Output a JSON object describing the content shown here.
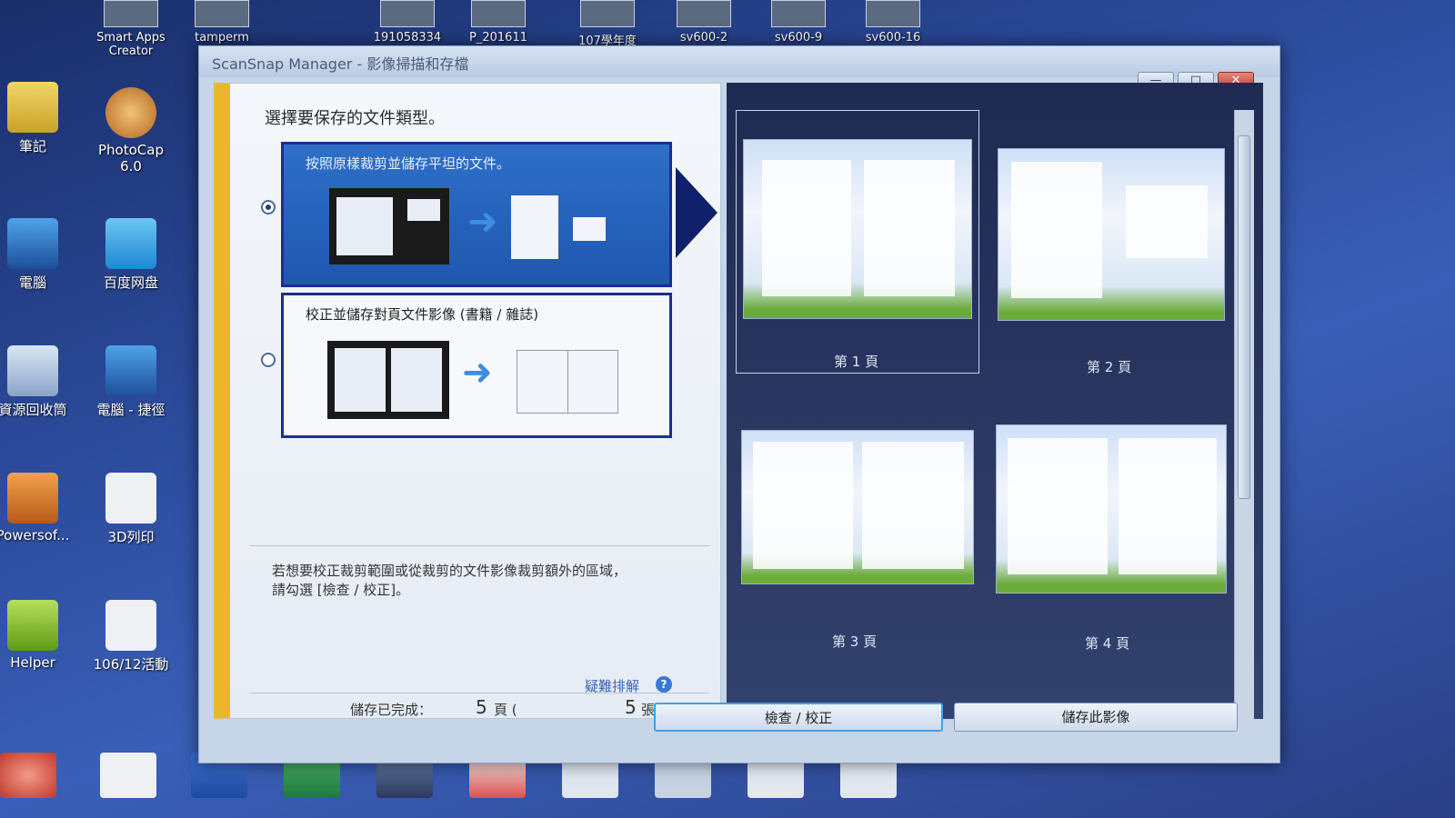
{
  "desktop": {
    "top_icons": [
      "Smart Apps Creator",
      "tamperm",
      "191058334",
      "P_201611",
      "107學年度",
      "sv600-2",
      "sv600-9",
      "sv600-16"
    ],
    "left_icons": [
      {
        "label": "筆記"
      },
      {
        "label": "PhotoCap 6.0"
      },
      {
        "label": "電腦"
      },
      {
        "label": "百度网盘"
      },
      {
        "label": "資源回收筒"
      },
      {
        "label": "電腦 - 捷徑"
      },
      {
        "label": "Powersof..."
      },
      {
        "label": "3D列印"
      },
      {
        "label": "Helper"
      },
      {
        "label": "106/12活動"
      }
    ]
  },
  "window": {
    "title": "ScanSnap Manager - 影像掃描和存檔",
    "buttons": {
      "minimize": "—",
      "maximize": "□",
      "close": "✕"
    }
  },
  "left_panel": {
    "prompt": "選擇要保存的文件類型。",
    "option1_label": "按照原樣裁剪並儲存平坦的文件。",
    "option2_label": "校正並儲存對頁文件影像 (書籍 / 雜誌)",
    "note_line1": "若想要校正裁剪範圍或從裁剪的文件影像裁剪額外的區域，",
    "note_line2": "請勾選 [檢查 / 校正]。",
    "troubleshoot": "疑難排解",
    "help": "?",
    "status_label": "儲存已完成：",
    "pages_count": "5",
    "pages_unit": "頁 (",
    "sheets_count": "5",
    "sheets_unit": "張)"
  },
  "preview": {
    "pages": [
      "第 1 頁",
      "第 2 頁",
      "第 3 頁",
      "第 4 頁"
    ]
  },
  "buttons": {
    "check_correct": "檢查 / 校正",
    "save_image": "儲存此影像"
  },
  "colors": {
    "accent_yellow": "#e8b82a",
    "selected_option": "#2e6fc8",
    "option_border": "#1b2f8a",
    "preview_bg": "#1f2a52"
  }
}
